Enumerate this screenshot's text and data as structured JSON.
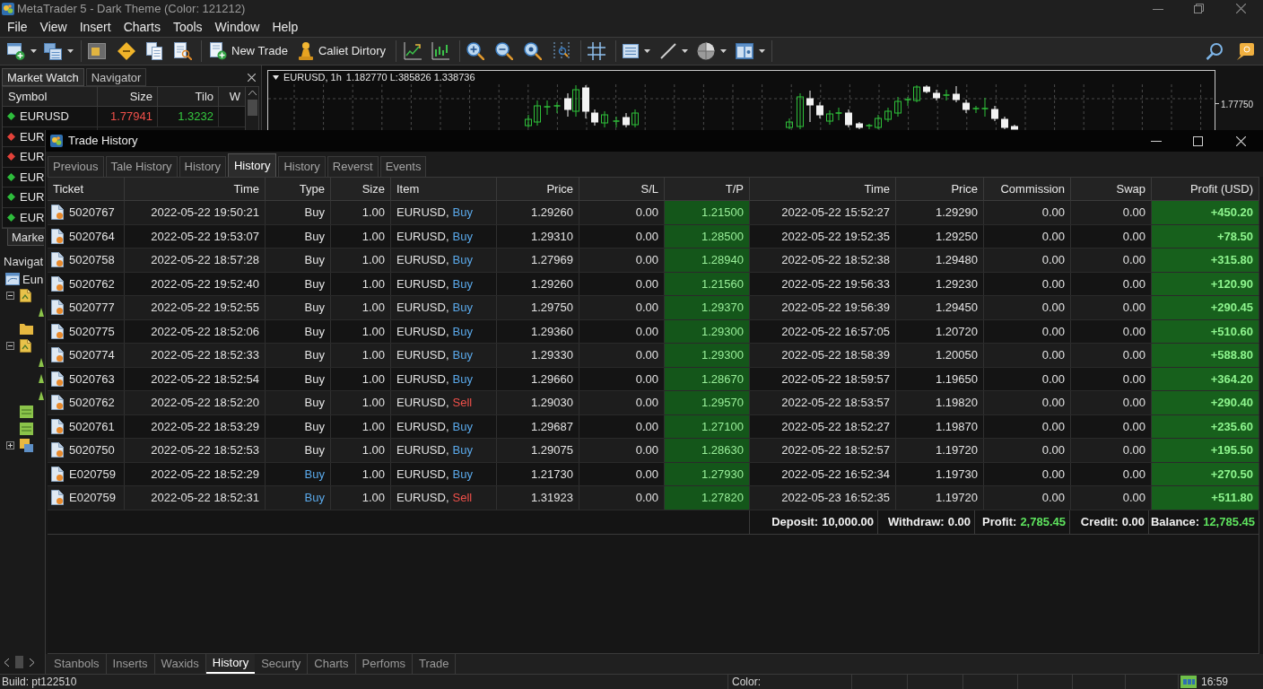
{
  "window": {
    "title": "MetaTrader 5 - Dark Theme (Color: 121212)"
  },
  "menu": [
    "File",
    "View",
    "Insert",
    "Charts",
    "Tools",
    "Window",
    "Help"
  ],
  "toolbar": {
    "new_trade": "New Trade",
    "algo": "Caliet Dirtory"
  },
  "market_watch": {
    "tabs": [
      {
        "label": "Market Watch",
        "selected": true
      },
      {
        "label": "Navigator",
        "selected": false
      }
    ],
    "columns": [
      "Symbol",
      "Size",
      "Tilo",
      "W"
    ],
    "rows": [
      {
        "symbol": "EURUSD",
        "color": "#2ebd3c",
        "size": "1.77941",
        "tilo": "1.3232"
      },
      {
        "symbol": "EUR",
        "color": "#e3423a"
      },
      {
        "symbol": "EUR",
        "color": "#e3423a"
      },
      {
        "symbol": "EUR",
        "color": "#2ebd3c"
      },
      {
        "symbol": "EUR",
        "color": "#2ebd3c"
      },
      {
        "symbol": "EUR",
        "color": "#2ebd3c"
      }
    ],
    "bottom_tab": "Marke"
  },
  "navigator": {
    "title": "Navigat",
    "tree": [
      {
        "label": "Eun",
        "children": [
          {
            "kind": "script",
            "expanded": true,
            "children": [
              {
                "kind": "item"
              }
            ]
          },
          {
            "kind": "folder"
          },
          {
            "kind": "script",
            "expanded": true,
            "children": [
              {
                "kind": "item"
              },
              {
                "kind": "item"
              },
              {
                "kind": "item"
              }
            ]
          },
          {
            "kind": "indicator"
          },
          {
            "kind": "indicator"
          },
          {
            "kind": "chart",
            "expanded": false
          }
        ]
      }
    ]
  },
  "chart": {
    "symbol": "EURUSD, 1h",
    "prices": "1.182770 L:385826 1.338736",
    "price_label": "1.77750"
  },
  "trade_history": {
    "title": "Trade History",
    "tabs": [
      {
        "label": "Previous",
        "selected": false
      },
      {
        "label": "Tale History",
        "selected": false
      },
      {
        "label": "History",
        "selected": false
      },
      {
        "label": "History",
        "selected": true
      },
      {
        "label": "History",
        "selected": false
      },
      {
        "label": "Reverst",
        "selected": false
      },
      {
        "label": "Events",
        "selected": false
      }
    ],
    "columns": [
      "Ticket",
      "Time",
      "Type",
      "Size",
      "Item",
      "Price",
      "S/L",
      "T/P",
      "Time",
      "Price",
      "Commission",
      "Swap",
      "Profit (USD)"
    ],
    "rows": [
      {
        "ticket": "5020767",
        "open_time": "2022-05-22 19:50:21",
        "type": "Buy",
        "type_colored": false,
        "size": "1.00",
        "symbol": "EURUSD,",
        "side": "Buy",
        "sell": false,
        "open_price": "1.29260",
        "sl": "0.00",
        "tp": "1.21500",
        "close_time": "2022-05-22 15:52:27",
        "close_price": "1.29290",
        "commission": "0.00",
        "swap": "0.00",
        "profit": "+450.20"
      },
      {
        "ticket": "5020764",
        "open_time": "2022-05-22 19:53:07",
        "type": "Buy",
        "type_colored": false,
        "size": "1.00",
        "symbol": "EURUSD,",
        "side": "Buy",
        "sell": false,
        "open_price": "1.29310",
        "sl": "0.00",
        "tp": "1.28500",
        "close_time": "2022-05-22 19:52:35",
        "close_price": "1.29250",
        "commission": "0.00",
        "swap": "0.00",
        "profit": "+78.50"
      },
      {
        "ticket": "5020758",
        "open_time": "2022-05-22 18:57:28",
        "type": "Buy",
        "type_colored": false,
        "size": "1.00",
        "symbol": "EURUSD,",
        "side": "Buy",
        "sell": false,
        "open_price": "1.27969",
        "sl": "0.00",
        "tp": "1.28940",
        "close_time": "2022-05-22 18:52:38",
        "close_price": "1.29480",
        "commission": "0.00",
        "swap": "0.00",
        "profit": "+315.80"
      },
      {
        "ticket": "5020762",
        "open_time": "2022-05-22 19:52:40",
        "type": "Buy",
        "type_colored": false,
        "size": "1.00",
        "symbol": "EURUSD,",
        "side": "Buy",
        "sell": false,
        "open_price": "1.29260",
        "sl": "0.00",
        "tp": "1.21560",
        "close_time": "2022-05-22 19:56:33",
        "close_price": "1.29230",
        "commission": "0.00",
        "swap": "0.00",
        "profit": "+120.90"
      },
      {
        "ticket": "5020777",
        "open_time": "2022-05-22 19:52:55",
        "type": "Buy",
        "type_colored": false,
        "size": "1.00",
        "symbol": "EURUSD,",
        "side": "Buy",
        "sell": false,
        "open_price": "1.29750",
        "sl": "0.00",
        "tp": "1.29370",
        "close_time": "2022-05-22 19:56:39",
        "close_price": "1.29450",
        "commission": "0.00",
        "swap": "0.00",
        "profit": "+290.45"
      },
      {
        "ticket": "5020775",
        "open_time": "2022-05-22 18:52:06",
        "type": "Buy",
        "type_colored": false,
        "size": "1.00",
        "symbol": "EURUSD,",
        "side": "Buy",
        "sell": false,
        "open_price": "1.29360",
        "sl": "0.00",
        "tp": "1.29300",
        "close_time": "2022-05-22 16:57:05",
        "close_price": "1.20720",
        "commission": "0.00",
        "swap": "0.00",
        "profit": "+510.60"
      },
      {
        "ticket": "5020774",
        "open_time": "2022-05-22 18:52:33",
        "type": "Buy",
        "type_colored": false,
        "size": "1.00",
        "symbol": "EURUSD,",
        "side": "Buy",
        "sell": false,
        "open_price": "1.29330",
        "sl": "0.00",
        "tp": "1.29300",
        "close_time": "2022-05-22 18:58:39",
        "close_price": "1.20050",
        "commission": "0.00",
        "swap": "0.00",
        "profit": "+588.80"
      },
      {
        "ticket": "5020763",
        "open_time": "2022-05-22 18:52:54",
        "type": "Buy",
        "type_colored": false,
        "size": "1.00",
        "symbol": "EURUSD,",
        "side": "Buy",
        "sell": false,
        "open_price": "1.29660",
        "sl": "0.00",
        "tp": "1.28670",
        "close_time": "2022-05-22 18:59:57",
        "close_price": "1.19650",
        "commission": "0.00",
        "swap": "0.00",
        "profit": "+364.20"
      },
      {
        "ticket": "5020762",
        "open_time": "2022-05-22 18:52:20",
        "type": "Buy",
        "type_colored": false,
        "size": "1.00",
        "symbol": "EURUSD,",
        "side": "Sell",
        "sell": true,
        "open_price": "1.29030",
        "sl": "0.00",
        "tp": "1.29570",
        "close_time": "2022-05-22 18:53:57",
        "close_price": "1.19820",
        "commission": "0.00",
        "swap": "0.00",
        "profit": "+290.40"
      },
      {
        "ticket": "5020761",
        "open_time": "2022-05-22 18:53:29",
        "type": "Buy",
        "type_colored": false,
        "size": "1.00",
        "symbol": "EURUSD,",
        "side": "Buy",
        "sell": false,
        "open_price": "1.29687",
        "sl": "0.00",
        "tp": "1.27100",
        "close_time": "2022-05-22 18:52:27",
        "close_price": "1.19870",
        "commission": "0.00",
        "swap": "0.00",
        "profit": "+235.60"
      },
      {
        "ticket": "5020750",
        "open_time": "2022-05-22 18:52:53",
        "type": "Buy",
        "type_colored": false,
        "size": "1.00",
        "symbol": "EURUSD,",
        "side": "Buy",
        "sell": false,
        "open_price": "1.29075",
        "sl": "0.00",
        "tp": "1.28630",
        "close_time": "2022-05-22 18:52:57",
        "close_price": "1.19720",
        "commission": "0.00",
        "swap": "0.00",
        "profit": "+195.50"
      },
      {
        "ticket": "E020759",
        "open_time": "2022-05-22 18:52:29",
        "type": "Buy",
        "type_colored": true,
        "size": "1.00",
        "symbol": "EURUSD,",
        "side": "Buy",
        "sell": false,
        "open_price": "1.21730",
        "sl": "0.00",
        "tp": "1.27930",
        "close_time": "2022-05-22 16:52:34",
        "close_price": "1.19730",
        "commission": "0.00",
        "swap": "0.00",
        "profit": "+270.50"
      },
      {
        "ticket": "E020759",
        "open_time": "2022-05-22 18:52:31",
        "type": "Buy",
        "type_colored": true,
        "size": "1.00",
        "symbol": "EURUSD,",
        "side": "Sell",
        "sell": true,
        "open_price": "1.31923",
        "sl": "0.00",
        "tp": "1.27820",
        "close_time": "2022-05-23 16:52:35",
        "close_price": "1.19720",
        "commission": "0.00",
        "swap": "0.00",
        "profit": "+511.80"
      }
    ],
    "summary": [
      {
        "label": "Deposit:",
        "value": "10,000.00",
        "highlighted": false
      },
      {
        "label": "Withdraw:",
        "value": "0.00",
        "highlighted": false
      },
      {
        "label": "Profit:",
        "value": "2,785.45",
        "highlighted": true
      },
      {
        "label": "Credit:",
        "value": "0.00",
        "highlighted": false
      },
      {
        "label": "Balance:",
        "value": "12,785.45",
        "highlighted": true
      }
    ],
    "bottom_tabs": [
      {
        "label": "Stanbols",
        "selected": false
      },
      {
        "label": "Inserts",
        "selected": false
      },
      {
        "label": "Waxids",
        "selected": false
      },
      {
        "label": "History",
        "selected": true
      },
      {
        "label": "Securty",
        "selected": false
      },
      {
        "label": "Charts",
        "selected": false
      },
      {
        "label": "Perfoms",
        "selected": false
      },
      {
        "label": "Trade",
        "selected": false
      }
    ]
  },
  "status_bar": {
    "build": "Build: pt122510",
    "color_label": "Color:",
    "time": "16:59"
  }
}
